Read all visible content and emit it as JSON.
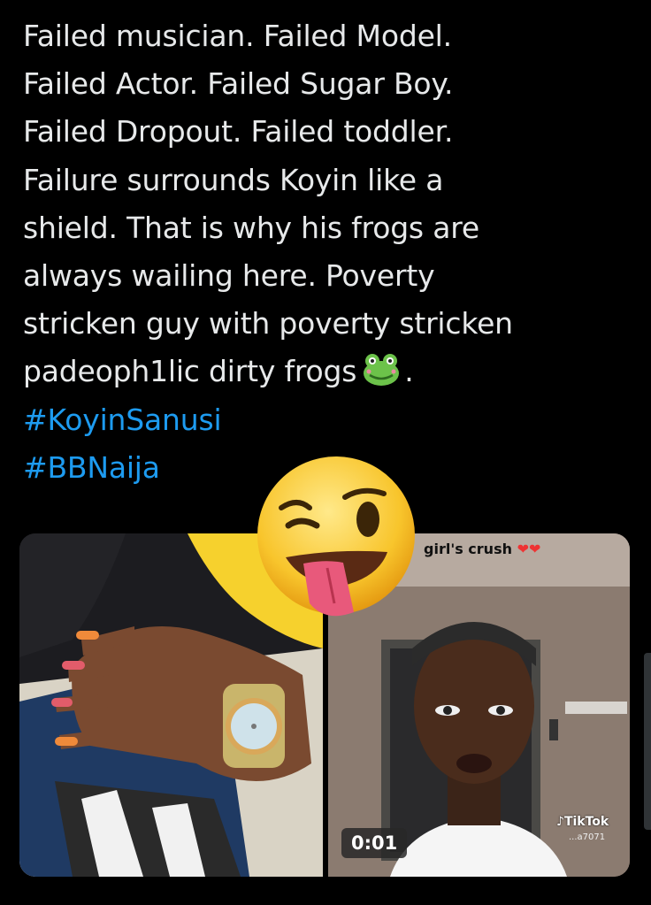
{
  "tweet": {
    "lines": [
      "Failed musician. Failed Model.",
      "Failed Actor. Failed Sugar Boy.",
      "Failed Dropout. Failed toddler.",
      "Failure surrounds Koyin like a",
      "shield. That is why his frogs are",
      "always wailing here. Poverty",
      "stricken guy with poverty stricken"
    ],
    "last_line_text": "padeoph1lic dirty frogs",
    "last_line_end": ".",
    "hashtags": [
      "#KoyinSanusi",
      "#BBNaija"
    ]
  },
  "video": {
    "caption": "girl's crush",
    "duration": "0:01",
    "watermark": "TikTok",
    "watermark_user": "...a7071"
  },
  "icons": [
    "frog-emoji-icon",
    "winking-tongue-emoji-icon",
    "tiktok-logo-icon",
    "heart-emoji-icon"
  ],
  "colors": {
    "background": "#000000",
    "text": "#e7e9ea",
    "hashtag": "#1d9bf0"
  }
}
